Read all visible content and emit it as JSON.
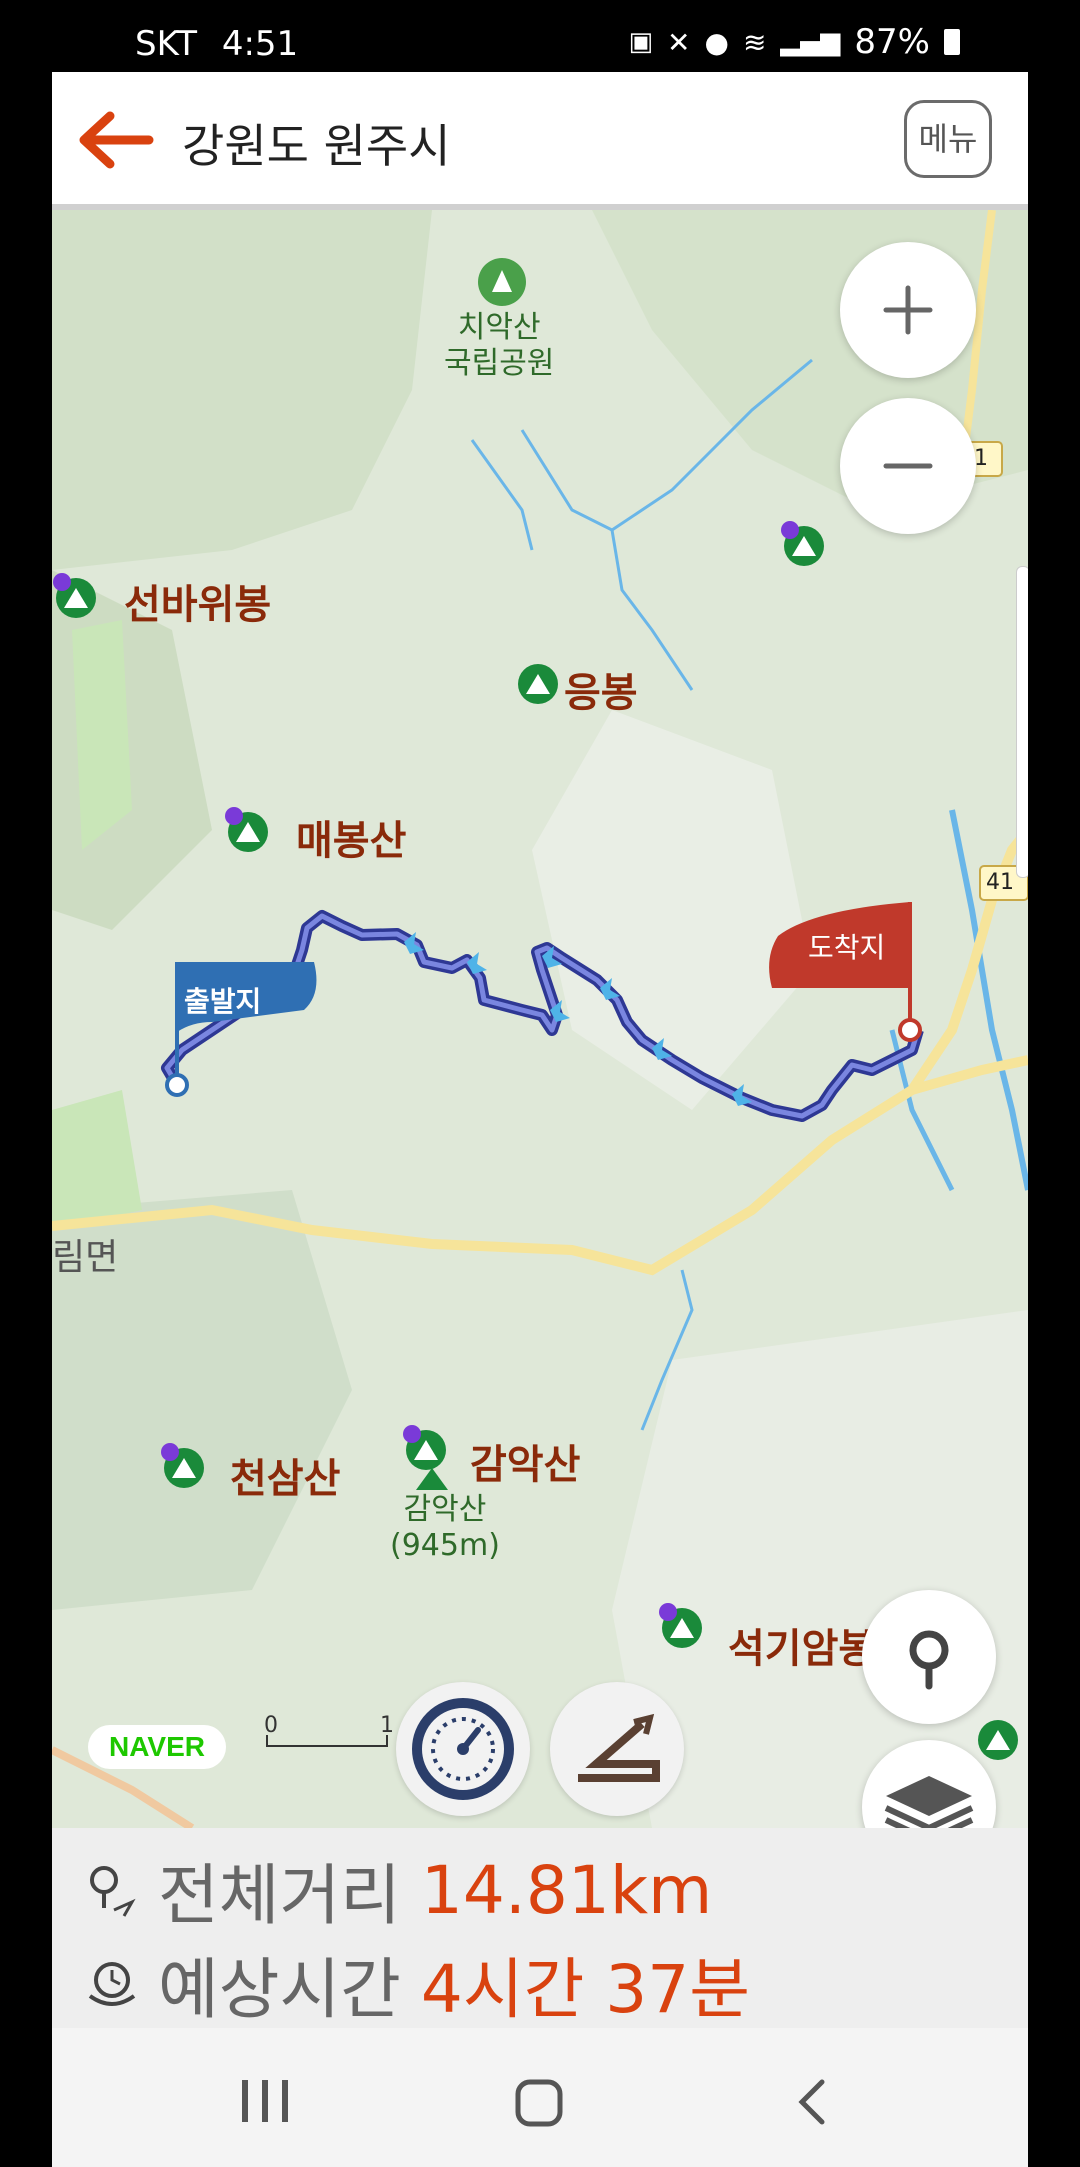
{
  "status_bar": {
    "carrier": "SKT",
    "time": "4:51",
    "battery": "87%"
  },
  "header": {
    "title": "강원도 원주시",
    "menu_label": "메뉴"
  },
  "map": {
    "labels": {
      "chiaksan": "치악산\n국립공원",
      "seonbawibong": "선바위봉",
      "eungbong": "응봉",
      "maebongsan": "매봉산",
      "rimmyeon": "림면",
      "cheonsamsan": "천삼산",
      "gamaksan": "감악산",
      "gamaksan_small": "감악산\n(945m)",
      "seokgiambong": "석기암봉",
      "start_flag": "출발지",
      "end_flag": "도착지",
      "road_shield_1": "1",
      "road_shield_2": "41"
    },
    "logo": "NAVER",
    "scale": {
      "min": "0",
      "max": "1"
    }
  },
  "route_info": {
    "distance_label": "전체거리",
    "distance_value": "14.81km",
    "time_label": "예상시간",
    "time_value": "4시간 37분"
  },
  "colors": {
    "accent": "#d9420f",
    "route": "#4a55b8",
    "start_flag": "#2f6fb3",
    "end_flag": "#c0392b"
  },
  "icons": [
    "back-arrow-icon",
    "zoom-in-icon",
    "zoom-out-icon",
    "location-icon",
    "layers-icon",
    "speedometer-icon",
    "elevation-icon",
    "distance-icon",
    "time-icon"
  ]
}
